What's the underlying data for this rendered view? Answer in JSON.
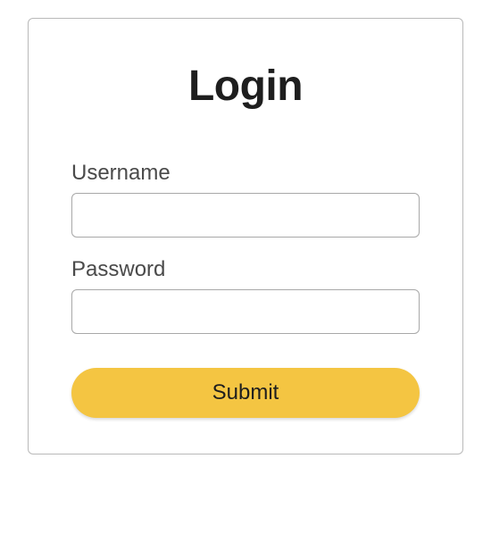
{
  "login": {
    "title": "Login",
    "username_label": "Username",
    "username_value": "",
    "password_label": "Password",
    "password_value": "",
    "submit_label": "Submit"
  }
}
